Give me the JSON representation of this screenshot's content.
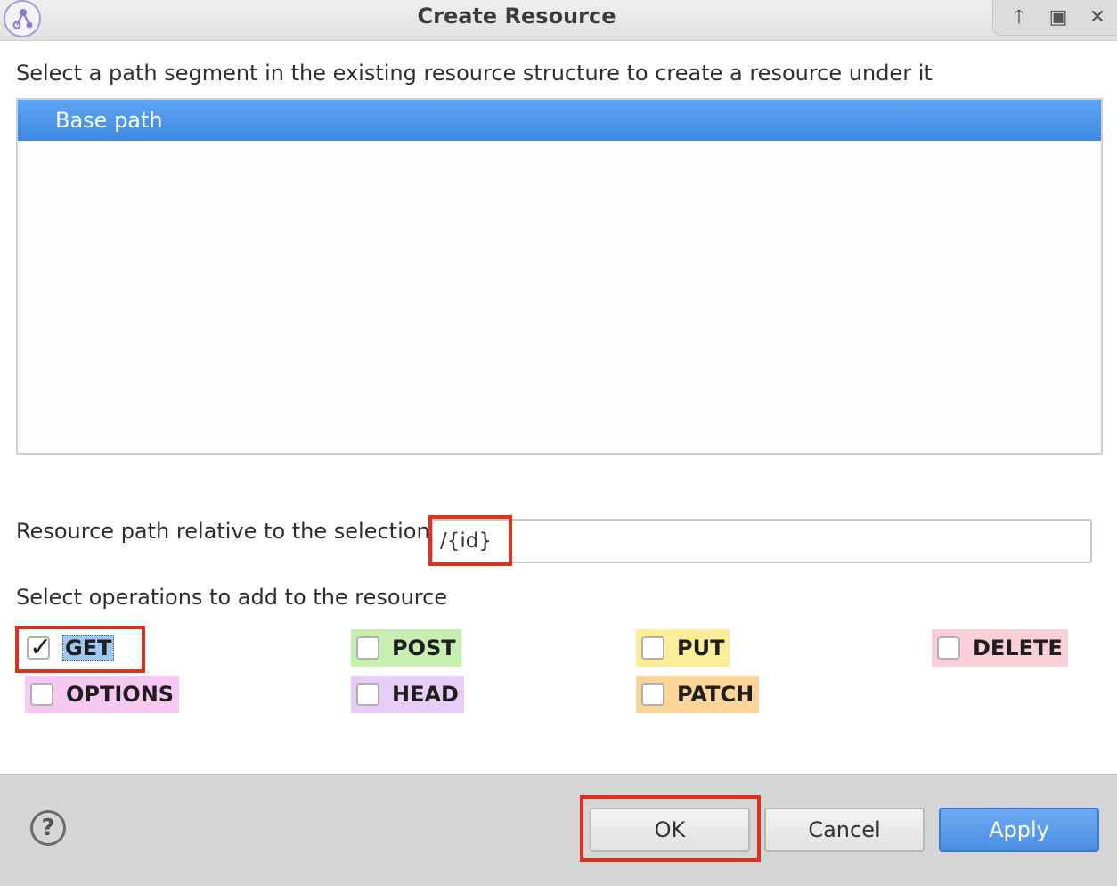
{
  "window": {
    "title": "Create Resource"
  },
  "tree": {
    "instruction": "Select a path segment in the existing resource structure to create a resource under it",
    "items": [
      {
        "label": "Base path",
        "selected": true
      }
    ]
  },
  "path": {
    "label": "Resource path relative to the selection",
    "value": "/{id}"
  },
  "operations": {
    "label": "Select operations to add to the resource",
    "items": [
      {
        "label": "GET",
        "checked": true,
        "color": "#9fc7ef"
      },
      {
        "label": "POST",
        "checked": false,
        "color": "#c8eeb2"
      },
      {
        "label": "PUT",
        "checked": false,
        "color": "#fbee9a"
      },
      {
        "label": "DELETE",
        "checked": false,
        "color": "#f9cfd9"
      },
      {
        "label": "OPTIONS",
        "checked": false,
        "color": "#f7c9f2"
      },
      {
        "label": "HEAD",
        "checked": false,
        "color": "#e6ccf6"
      },
      {
        "label": "PATCH",
        "checked": false,
        "color": "#fbd49a"
      }
    ]
  },
  "buttons": {
    "help": "?",
    "ok": "OK",
    "cancel": "Cancel",
    "apply": "Apply"
  }
}
